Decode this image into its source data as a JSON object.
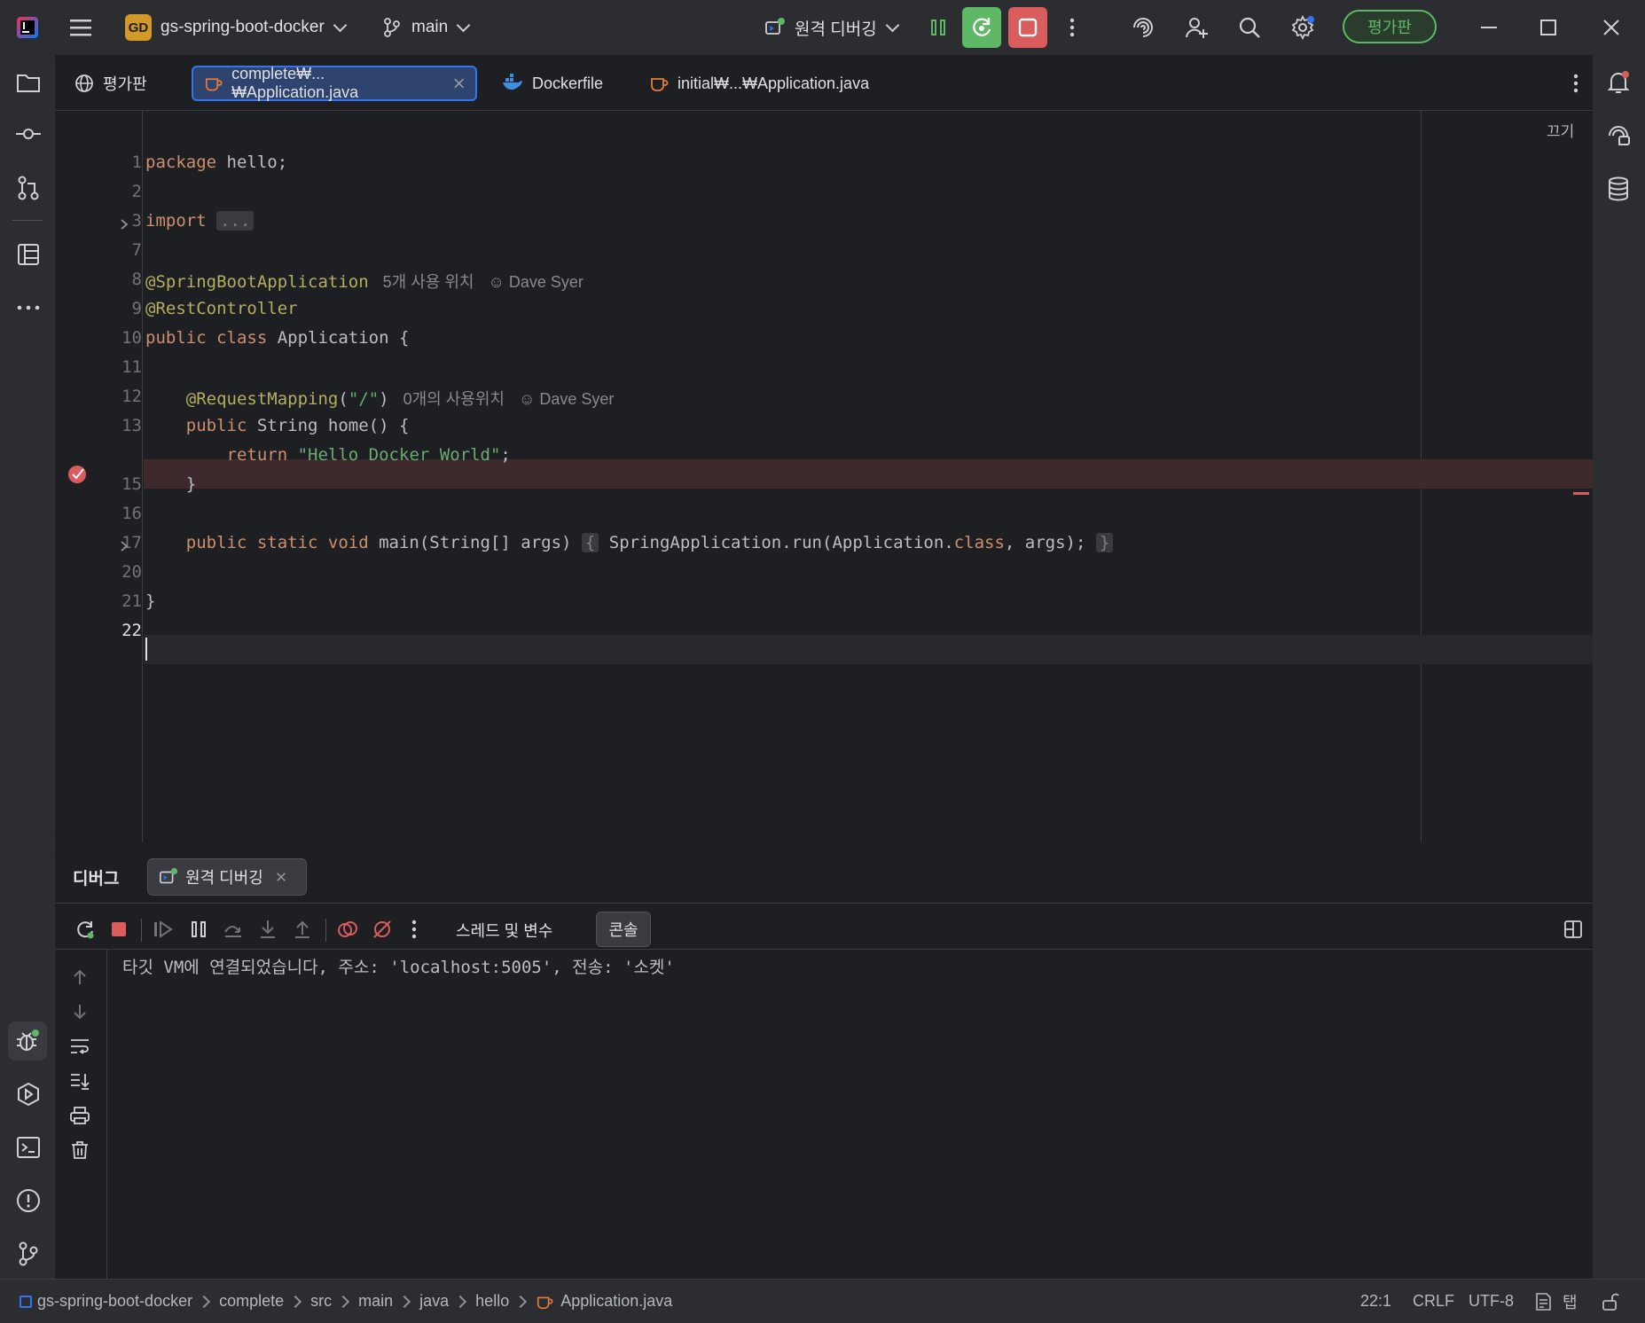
{
  "titlebar": {
    "project_badge": "GD",
    "project_name": "gs-spring-boot-docker",
    "branch": "main",
    "run_config": "원격 디버깅",
    "eval_button": "평가판"
  },
  "tabs": [
    {
      "label": "평가판",
      "icon": "globe-icon"
    },
    {
      "label": "complete₩...₩Application.java",
      "icon": "java-file-icon",
      "active": true
    },
    {
      "label": "Dockerfile",
      "icon": "docker-icon"
    },
    {
      "label": "initial₩...₩Application.java",
      "icon": "java-file-icon"
    }
  ],
  "editor": {
    "reader_mode": "끄기",
    "line_numbers": [
      "1",
      "2",
      "3",
      "7",
      "8",
      "9",
      "10",
      "11",
      "12",
      "13",
      "",
      "15",
      "16",
      "17",
      "20",
      "21",
      "22"
    ],
    "line8_hint": "5개 사용 위치",
    "line8_author": "Dave Syer",
    "line12_hint": "0개의 사용위치",
    "line12_author": "Dave Syer"
  },
  "debug": {
    "title": "디버그",
    "session_tab": "원격 디버깅",
    "threads_tab": "스레드 및 변수",
    "console_tab": "콘솔",
    "console_output": "타깃 VM에 연결되었습니다, 주소: 'localhost:5005', 전송: '소켓'"
  },
  "statusbar": {
    "breadcrumbs": [
      "gs-spring-boot-docker",
      "complete",
      "src",
      "main",
      "java",
      "hello",
      "Application.java"
    ],
    "position": "22:1",
    "line_sep": "CRLF",
    "encoding": "UTF-8",
    "indent": "탭"
  },
  "colors": {
    "accent": "#3574f0",
    "breakpoint": "#db5c5c",
    "run_green": "#5fb865",
    "stop_red": "#db5c5c"
  }
}
